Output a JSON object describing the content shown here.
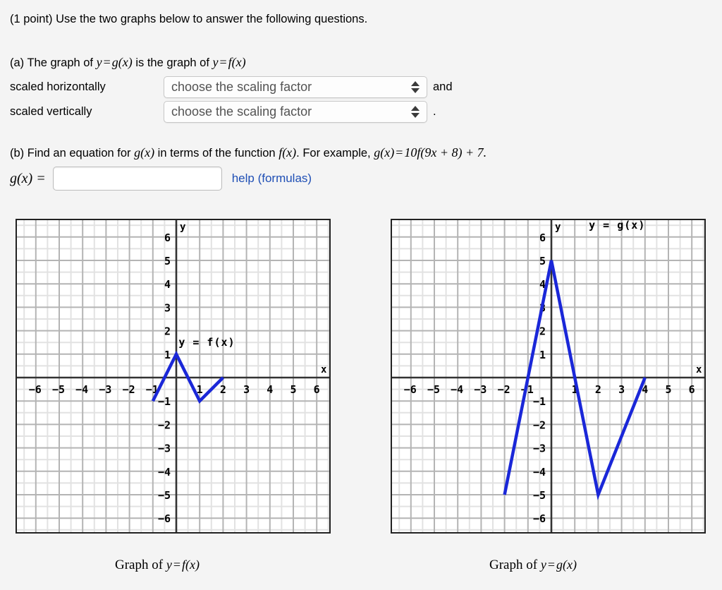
{
  "intro": {
    "text": "(1 point) Use the two graphs below to answer the following questions."
  },
  "part_a": {
    "prefix": "(a) The graph of ",
    "g_of_x": "g(x)",
    "middle": " is the graph of ",
    "f_of_x": "f(x)",
    "y1": "y",
    "eq1": "=",
    "y2": "y",
    "eq2": "=",
    "row_horizontal_label": "scaled horizontally",
    "row_vertical_label": "scaled vertically",
    "select_placeholder": "choose the scaling factor",
    "conjunction": "and",
    "period": ".",
    "options": [
      "choose the scaling factor"
    ]
  },
  "part_b": {
    "text_1": "(b) Find an equation for ",
    "g_of_x": "g(x)",
    "text_2": " in terms of the function ",
    "f_of_x": "f(x)",
    "text_3": ". For example, ",
    "example_lhs": "g(x)",
    "example_eq": "=",
    "example_rhs": "10f(9x + 8) + 7.",
    "answer_label": "g(x) =",
    "answer_value": "",
    "answer_placeholder": "",
    "help_link": "help (formulas)"
  },
  "graphs": {
    "caption_f": "Graph of y = f(x)",
    "caption_g": "Graph of y = g(x)",
    "f": {
      "curve_label": "y = f(x)",
      "x_axis_label": "x",
      "y_axis_label": "y",
      "x_ticks": [
        "-6",
        "-5",
        "-4",
        "-3",
        "-2",
        "-1",
        "1",
        "2",
        "3",
        "4",
        "5",
        "6"
      ],
      "y_ticks": [
        "6",
        "5",
        "4",
        "3",
        "2",
        "1",
        "-1",
        "-2",
        "-3",
        "-4",
        "-5",
        "-6"
      ],
      "curve_color": "#1a27d8"
    },
    "g": {
      "curve_label": "y = g(x)",
      "x_axis_label": "x",
      "y_axis_label": "y",
      "x_ticks": [
        "-6",
        "-5",
        "-4",
        "-3",
        "-2",
        "-1",
        "1",
        "2",
        "3",
        "4",
        "5",
        "6"
      ],
      "y_ticks": [
        "6",
        "5",
        "4",
        "3",
        "2",
        "1",
        "-1",
        "-2",
        "-3",
        "-4",
        "-5",
        "-6"
      ],
      "curve_color": "#1a27d8"
    }
  },
  "chart_data": [
    {
      "type": "line",
      "title": "Graph of y = f(x)",
      "xlabel": "x",
      "ylabel": "y",
      "xlim": [
        -6.75,
        6.75
      ],
      "ylim": [
        -6.75,
        6.75
      ],
      "grid": true,
      "major_grid_step": 1,
      "minor_grid_step": 0.5,
      "xticks": [
        -6,
        -5,
        -4,
        -3,
        -2,
        -1,
        1,
        2,
        3,
        4,
        5,
        6
      ],
      "yticks": [
        6,
        5,
        4,
        3,
        2,
        1,
        -1,
        -2,
        -3,
        -4,
        -5,
        -6
      ],
      "series": [
        {
          "name": "y = f(x)",
          "color": "#1a27d8",
          "points": [
            [
              -1,
              -1
            ],
            [
              0,
              1
            ],
            [
              1,
              -1
            ],
            [
              2,
              0
            ]
          ]
        }
      ],
      "annotations": [
        {
          "text": "y = f(x)",
          "x": 0.1,
          "y": 1.35
        }
      ]
    },
    {
      "type": "line",
      "title": "Graph of y = g(x)",
      "xlabel": "x",
      "ylabel": "y",
      "xlim": [
        -6.75,
        6.75
      ],
      "ylim": [
        -6.75,
        6.75
      ],
      "grid": true,
      "major_grid_step": 1,
      "minor_grid_step": 0.5,
      "xticks": [
        -6,
        -5,
        -4,
        -3,
        -2,
        -1,
        1,
        2,
        3,
        4,
        5,
        6
      ],
      "yticks": [
        6,
        5,
        4,
        3,
        2,
        1,
        -1,
        -2,
        -3,
        -4,
        -5,
        -6
      ],
      "series": [
        {
          "name": "y = g(x)",
          "color": "#1a27d8",
          "points": [
            [
              -2,
              -5
            ],
            [
              0,
              5
            ],
            [
              2,
              -5
            ],
            [
              4,
              0
            ]
          ]
        }
      ],
      "annotations": [
        {
          "text": "y = g(x)",
          "x": 1.6,
          "y": 6.35
        }
      ]
    }
  ]
}
